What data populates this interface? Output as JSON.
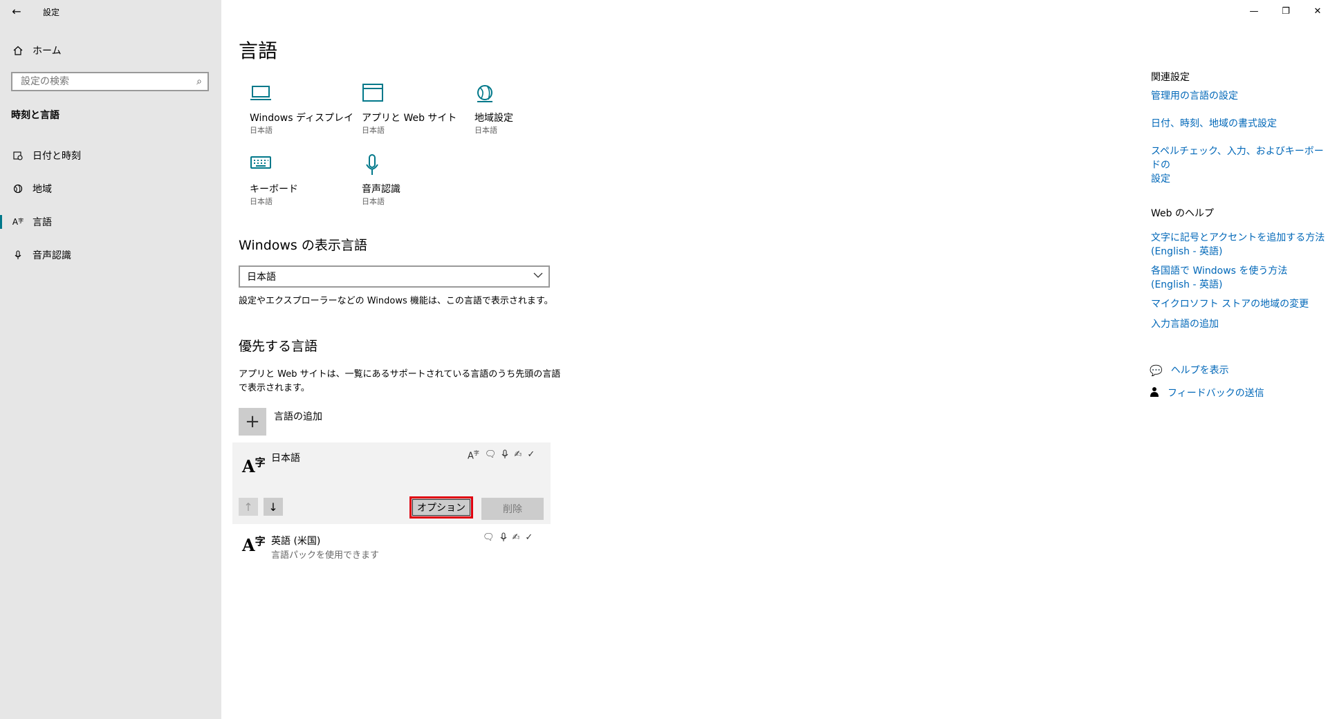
{
  "window": {
    "back_icon": "back-arrow-icon",
    "title": "設定",
    "controls": [
      "minimize-icon",
      "restore-icon",
      "close-icon"
    ]
  },
  "sidebar": {
    "home_label": "ホーム",
    "search_placeholder": "設定の検索",
    "section_title": "時刻と言語",
    "items": [
      {
        "label": "日付と時刻",
        "icon": "calendar-clock-icon",
        "active": false
      },
      {
        "label": "地域",
        "icon": "globe-icon",
        "active": false
      },
      {
        "label": "言語",
        "icon": "language-icon",
        "active": true
      },
      {
        "label": "音声認識",
        "icon": "microphone-icon",
        "active": false
      }
    ]
  },
  "main": {
    "title": "言語",
    "tiles": [
      {
        "label": "Windows ディスプレイ",
        "sub": "日本語",
        "icon": "laptop-icon"
      },
      {
        "label": "アプリと Web サイト",
        "sub": "日本語",
        "icon": "window-icon"
      },
      {
        "label": "地域設定",
        "sub": "日本語",
        "icon": "globe-icon"
      },
      {
        "label": "キーボード",
        "sub": "日本語",
        "icon": "keyboard-icon"
      },
      {
        "label": "音声認識",
        "sub": "日本語",
        "icon": "microphone-icon"
      }
    ],
    "display_language": {
      "heading": "Windows の表示言語",
      "selected": "日本語",
      "description": "設定やエクスプローラーなどの Windows 機能は、この言語で表示されます。"
    },
    "preferred": {
      "heading": "優先する言語",
      "description_line1": "アプリと Web サイトは、一覧にあるサポートされている言語のうち先頭の言語",
      "description_line2": "で表示されます。",
      "add_label": "言語の追加",
      "languages": [
        {
          "glyph_a": "A",
          "glyph_b": "字",
          "name": "日本語",
          "sub": "",
          "features": [
            "display-language-icon",
            "speech-icon",
            "microphone-icon",
            "handwriting-icon",
            "spellcheck-icon"
          ]
        },
        {
          "glyph_a": "A",
          "glyph_b": "字",
          "name": "英語 (米国)",
          "sub": "言語パックを使用できます",
          "features": [
            "speech-icon",
            "microphone-icon",
            "handwriting-icon",
            "spellcheck-icon"
          ]
        }
      ],
      "options_label": "オプション",
      "remove_label": "削除"
    }
  },
  "related": {
    "heading": "関連設定",
    "links": [
      "管理用の言語の設定",
      "日付、時刻、地域の書式設定",
      "スペルチェック、入力、およびキーボードの",
      "設定"
    ]
  },
  "web_help": {
    "heading": "Web のヘルプ",
    "links": [
      "文字に記号とアクセントを追加する方法",
      "(English - 英語)",
      "各国語で Windows を使う方法",
      "(English - 英語)",
      "マイクロソフト ストアの地域の変更",
      "入力言語の追加"
    ]
  },
  "support": {
    "help_label": "ヘルプを表示",
    "feedback_label": "フィードバックの送信"
  },
  "colors": {
    "accent": "#00788a",
    "link": "#0067b8",
    "highlight": "#e0000f",
    "sidebar": "#e6e6e6"
  }
}
